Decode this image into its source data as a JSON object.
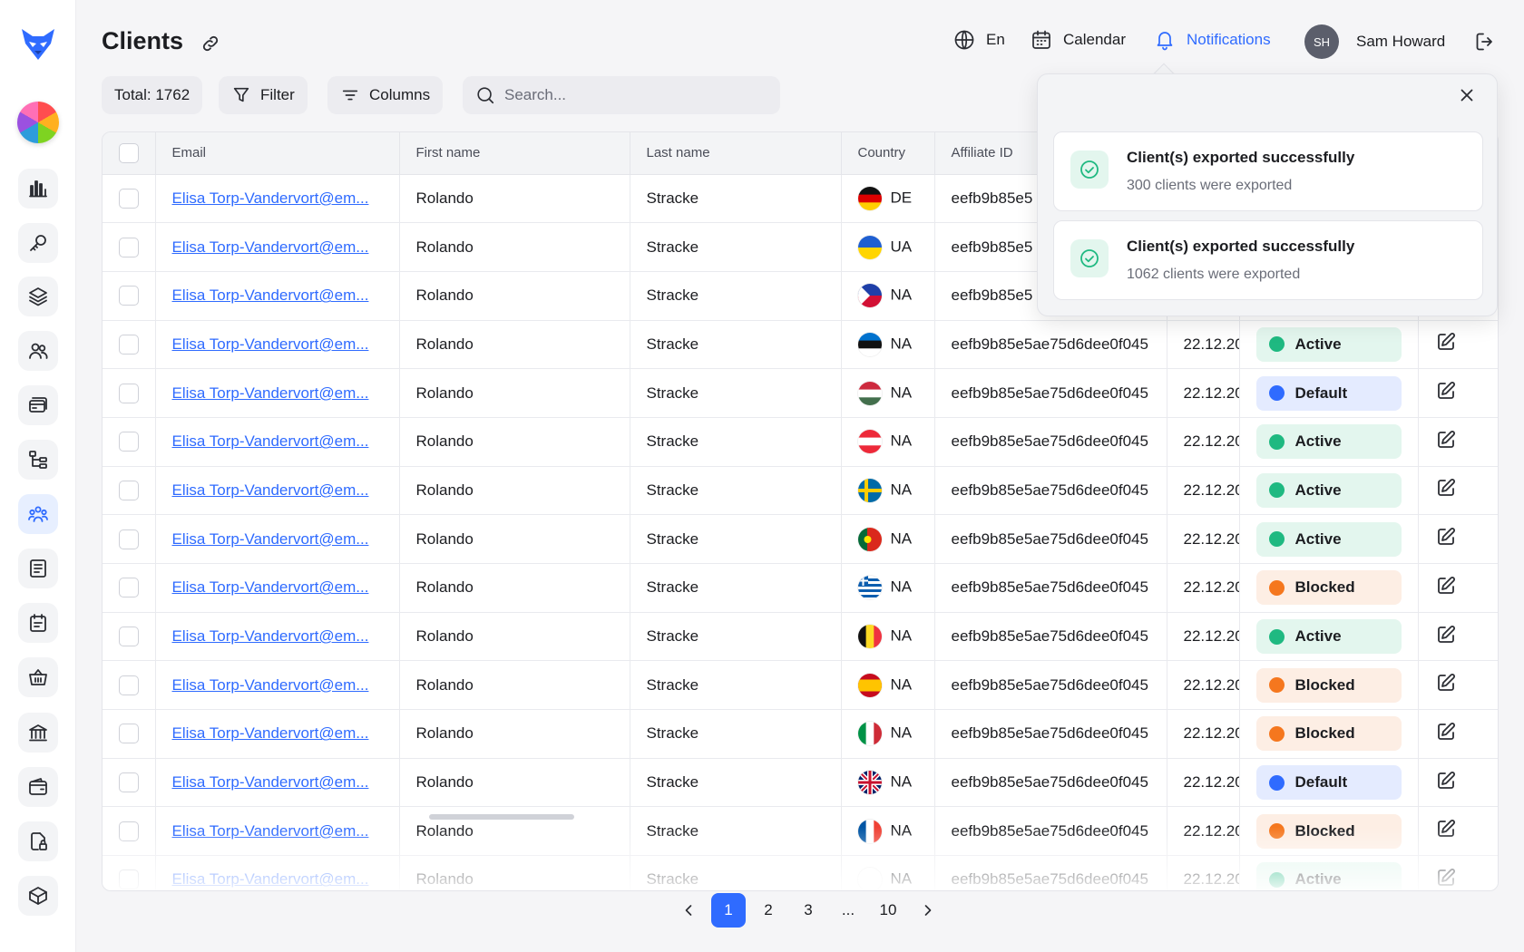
{
  "header": {
    "title": "Clients",
    "language": "En",
    "calendar_label": "Calendar",
    "notifications_label": "Notifications",
    "user": {
      "initials": "SH",
      "name": "Sam Howard"
    }
  },
  "toolbar": {
    "total_label": "Total: 1762",
    "filter_label": "Filter",
    "columns_label": "Columns",
    "search_placeholder": "Search..."
  },
  "sidebar": {
    "items": [
      "dashboard-chart-icon",
      "key-icon",
      "layers-icon",
      "users-icon",
      "cards-icon",
      "hierarchy-icon",
      "clients-group-icon",
      "document-icon",
      "task-icon",
      "basket-icon",
      "bank-icon",
      "wallet-icon",
      "secure-file-icon",
      "box-icon"
    ],
    "active_index": 6
  },
  "table": {
    "columns": [
      "Email",
      "First name",
      "Last name",
      "Country",
      "Affiliate ID"
    ],
    "rows": [
      {
        "email": "Elisa Torp-Vandervort@em...",
        "first": "Rolando",
        "last": "Stracke",
        "flag": "de",
        "country": "DE",
        "affiliate": "eefb9b85e5",
        "date": "",
        "status": "",
        "status_key": ""
      },
      {
        "email": "Elisa Torp-Vandervort@em...",
        "first": "Rolando",
        "last": "Stracke",
        "flag": "ua",
        "country": "UA",
        "affiliate": "eefb9b85e5",
        "date": "",
        "status": "",
        "status_key": ""
      },
      {
        "email": "Elisa Torp-Vandervort@em...",
        "first": "Rolando",
        "last": "Stracke",
        "flag": "ph",
        "country": "NA",
        "affiliate": "eefb9b85e5",
        "date": "",
        "status": "",
        "status_key": ""
      },
      {
        "email": "Elisa Torp-Vandervort@em...",
        "first": "Rolando",
        "last": "Stracke",
        "flag": "ee",
        "country": "NA",
        "affiliate": "eefb9b85e5ae75d6dee0f045",
        "date": "22.12.20",
        "status": "Active",
        "status_key": "active"
      },
      {
        "email": "Elisa Torp-Vandervort@em...",
        "first": "Rolando",
        "last": "Stracke",
        "flag": "hu",
        "country": "NA",
        "affiliate": "eefb9b85e5ae75d6dee0f045",
        "date": "22.12.20",
        "status": "Default",
        "status_key": "default"
      },
      {
        "email": "Elisa Torp-Vandervort@em...",
        "first": "Rolando",
        "last": "Stracke",
        "flag": "at",
        "country": "NA",
        "affiliate": "eefb9b85e5ae75d6dee0f045",
        "date": "22.12.20",
        "status": "Active",
        "status_key": "active"
      },
      {
        "email": "Elisa Torp-Vandervort@em...",
        "first": "Rolando",
        "last": "Stracke",
        "flag": "se",
        "country": "NA",
        "affiliate": "eefb9b85e5ae75d6dee0f045",
        "date": "22.12.20",
        "status": "Active",
        "status_key": "active"
      },
      {
        "email": "Elisa Torp-Vandervort@em...",
        "first": "Rolando",
        "last": "Stracke",
        "flag": "pt",
        "country": "NA",
        "affiliate": "eefb9b85e5ae75d6dee0f045",
        "date": "22.12.20",
        "status": "Active",
        "status_key": "active"
      },
      {
        "email": "Elisa Torp-Vandervort@em...",
        "first": "Rolando",
        "last": "Stracke",
        "flag": "gr",
        "country": "NA",
        "affiliate": "eefb9b85e5ae75d6dee0f045",
        "date": "22.12.20",
        "status": "Blocked",
        "status_key": "blocked"
      },
      {
        "email": "Elisa Torp-Vandervort@em...",
        "first": "Rolando",
        "last": "Stracke",
        "flag": "be",
        "country": "NA",
        "affiliate": "eefb9b85e5ae75d6dee0f045",
        "date": "22.12.20",
        "status": "Active",
        "status_key": "active"
      },
      {
        "email": "Elisa Torp-Vandervort@em...",
        "first": "Rolando",
        "last": "Stracke",
        "flag": "es",
        "country": "NA",
        "affiliate": "eefb9b85e5ae75d6dee0f045",
        "date": "22.12.20",
        "status": "Blocked",
        "status_key": "blocked"
      },
      {
        "email": "Elisa Torp-Vandervort@em...",
        "first": "Rolando",
        "last": "Stracke",
        "flag": "it",
        "country": "NA",
        "affiliate": "eefb9b85e5ae75d6dee0f045",
        "date": "22.12.20",
        "status": "Blocked",
        "status_key": "blocked"
      },
      {
        "email": "Elisa Torp-Vandervort@em...",
        "first": "Rolando",
        "last": "Stracke",
        "flag": "gb",
        "country": "NA",
        "affiliate": "eefb9b85e5ae75d6dee0f045",
        "date": "22.12.20",
        "status": "Default",
        "status_key": "default"
      },
      {
        "email": "Elisa Torp-Vandervort@em...",
        "first": "Rolando",
        "last": "Stracke",
        "flag": "fr",
        "country": "NA",
        "affiliate": "eefb9b85e5ae75d6dee0f045",
        "date": "22.12.20",
        "status": "Blocked",
        "status_key": "blocked"
      },
      {
        "email": "Elisa Torp-Vandervort@em...",
        "first": "Rolando",
        "last": "Stracke",
        "flag": "blank",
        "country": "NA",
        "affiliate": "eefb9b85e5ae75d6dee0f045",
        "date": "22.12.20",
        "status": "Active",
        "status_key": "active"
      }
    ]
  },
  "pagination": {
    "pages": [
      "1",
      "2",
      "3",
      "...",
      "10"
    ],
    "current": "1"
  },
  "notifications": [
    {
      "title": "Client(s) exported successfully",
      "subtitle": "300 clients were exported"
    },
    {
      "title": "Client(s) exported successfully",
      "subtitle": "1062 clients were exported"
    }
  ],
  "colors": {
    "accent": "#2f6bff",
    "active": "#1fb981",
    "blocked": "#f5771e"
  }
}
